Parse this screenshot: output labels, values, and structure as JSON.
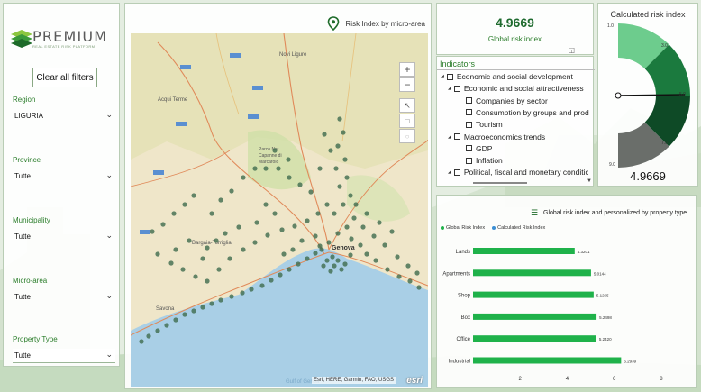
{
  "app": {
    "logo_text": "PREMIUM",
    "logo_subtitle": "REAL ESTATE RISK PLATFORM"
  },
  "filters": {
    "clear_label": "Clear all filters",
    "items": [
      {
        "label": "Region",
        "value": "LIGURIA"
      },
      {
        "label": "Province",
        "value": "Tutte"
      },
      {
        "label": "Municipality",
        "value": "Tutte"
      },
      {
        "label": "Micro-area",
        "value": "Tutte"
      },
      {
        "label": "Property Type",
        "value": "Tutte"
      }
    ]
  },
  "map": {
    "title": "Risk Index by micro-area",
    "attribution": "Esri, HERE, Garmin, FAO, USGS",
    "logo": "esri",
    "zoom_in": "+",
    "zoom_out": "−",
    "place_labels": [
      "Novi Ligure",
      "Acqui Terme",
      "Parco Nat. Capanne di Marcarolo",
      "Genova",
      "Savona",
      "Bargaia-Torriglia",
      "Gulf of Genoa"
    ]
  },
  "kpi": {
    "value": "4.9669",
    "label": "Global risk index"
  },
  "gauge": {
    "title": "Calculated risk index",
    "value": "4.9669",
    "value_number": 4.9669,
    "min": 1.0,
    "max": 9.0,
    "ticks": [
      "1.0",
      "3.0",
      "5.0",
      "7.0",
      "9.0"
    ],
    "colors": [
      "#6dcc8d",
      "#1b7a3e",
      "#0e4a26",
      "#6a6e6a"
    ]
  },
  "indicators": {
    "header": "Indicators",
    "items": [
      {
        "label": "Economic and social development",
        "level": 0,
        "expand": true
      },
      {
        "label": "Economic and social attractiveness",
        "level": 1,
        "expand": true
      },
      {
        "label": "Companies by sector",
        "level": 2,
        "expand": false
      },
      {
        "label": "Consumption by groups and produ",
        "level": 2,
        "expand": false
      },
      {
        "label": "Tourism",
        "level": 2,
        "expand": false
      },
      {
        "label": "Macroeconomics trends",
        "level": 1,
        "expand": true
      },
      {
        "label": "GDP",
        "level": 2,
        "expand": false
      },
      {
        "label": "Inflation",
        "level": 2,
        "expand": false
      },
      {
        "label": "Political, fiscal and monetary conditio",
        "level": 1,
        "expand": true
      }
    ]
  },
  "chart_title": "Global risk index and personalized by property type",
  "chart_data": {
    "type": "bar",
    "orientation": "horizontal",
    "categories": [
      "Lands",
      "Apartments",
      "Shop",
      "Box",
      "Office",
      "Industrial"
    ],
    "series": [
      {
        "name": "Global Risk Index",
        "color": "#1fb24a",
        "values": [
          4.3201,
          5.0144,
          5.1265,
          5.2498,
          5.242,
          6.2939
        ]
      }
    ],
    "data_labels": [
      "4.3201",
      "5.0144",
      "5.1265",
      "5.2498",
      "5.2420",
      "6.2939"
    ],
    "legend": [
      {
        "name": "Global Risk Index",
        "color": "#1fb24a"
      },
      {
        "name": "Calculated Risk Index",
        "color": "#3b8fd4"
      }
    ],
    "x_ticks": [
      "2",
      "4",
      "6",
      "8"
    ],
    "xlim": [
      0,
      9
    ]
  }
}
